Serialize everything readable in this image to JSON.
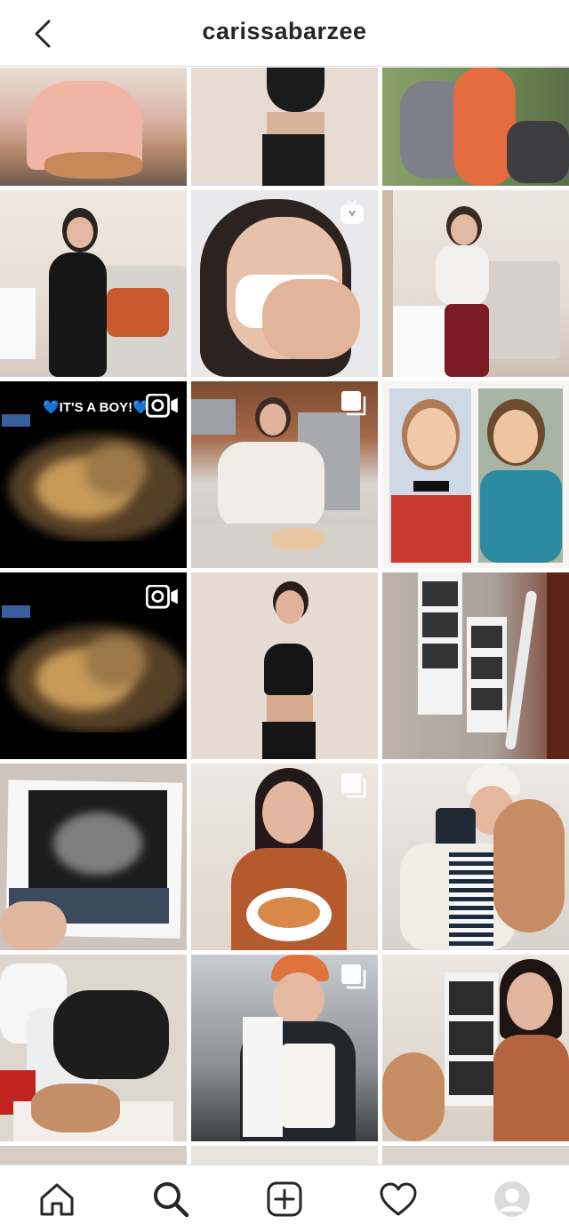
{
  "header": {
    "username": "carissabarzee",
    "back_icon": "chevron-left-icon"
  },
  "grid": {
    "overlay_texts": {
      "its_a_boy": "💙IT'S A BOY!💙"
    },
    "badge_icons": {
      "carousel": "multiple-photos-icon",
      "video": "video-camera-icon",
      "igtv": "igtv-icon"
    }
  },
  "bottom_nav": {
    "items": [
      "home-icon",
      "search-icon",
      "new-post-icon",
      "activity-heart-icon",
      "profile-avatar"
    ]
  },
  "colors": {
    "border": "#dbdbdb",
    "text": "#262626",
    "icon": "#262626"
  }
}
